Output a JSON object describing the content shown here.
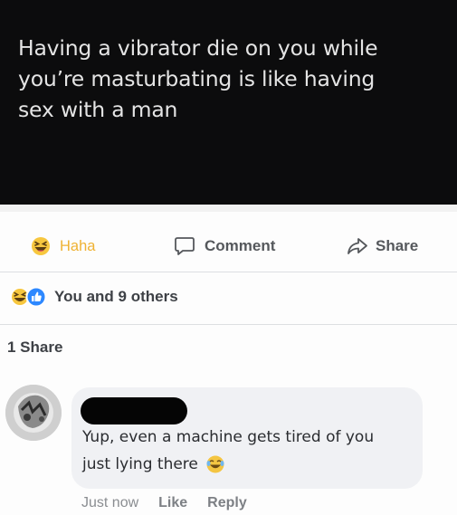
{
  "post": {
    "text_lines": [
      "Having a vibrator die on you while",
      "you’re masturbating is like having",
      "sex with a man"
    ]
  },
  "actions": {
    "haha_label": "Haha",
    "comment_label": "Comment",
    "share_label": "Share"
  },
  "reactions": {
    "summary": "You and 9 others",
    "icons": [
      "haha-reaction-icon",
      "like-reaction-icon"
    ]
  },
  "shares": {
    "count_text": "1 Share"
  },
  "comment": {
    "text_line1": "Yup, even a machine gets tired of you",
    "text_line2": "just lying there",
    "time": "Just now",
    "like_label": "Like",
    "reply_label": "Reply"
  },
  "colors": {
    "post_background": "#0c0c0d",
    "haha_accent": "#efb233",
    "like_blue": "#2d88ff",
    "bubble_background": "#f0f1f4"
  }
}
